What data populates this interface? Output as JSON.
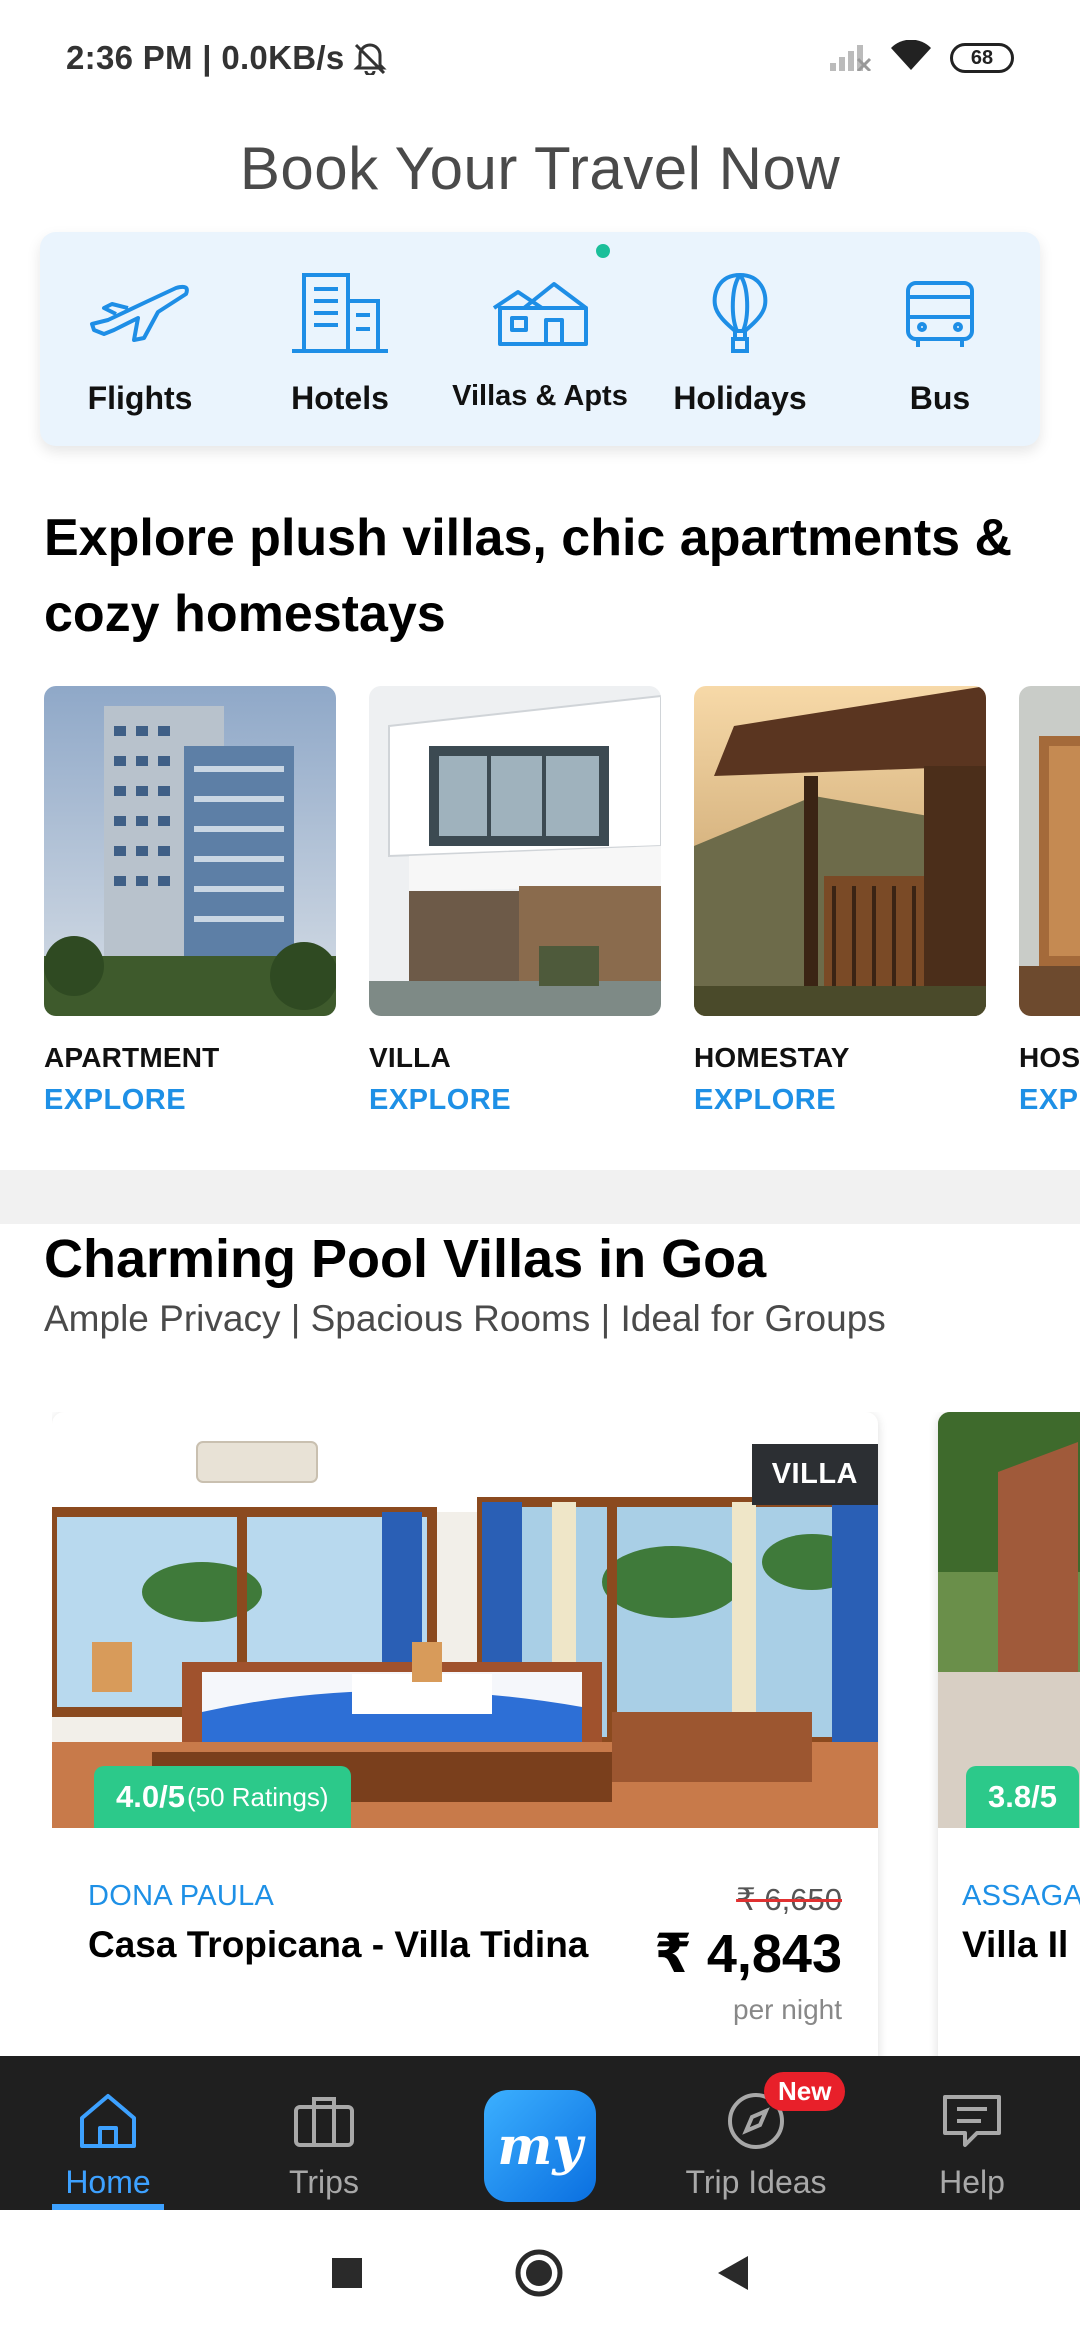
{
  "status_bar": {
    "time": "2:36 PM",
    "speed": "0.0KB/s",
    "battery": "68"
  },
  "page_title": "Book Your Travel Now",
  "categories": [
    {
      "label": "Flights",
      "icon": "airplane-icon"
    },
    {
      "label": "Hotels",
      "icon": "building-icon"
    },
    {
      "label": "Villas & Apts",
      "icon": "house-icon"
    },
    {
      "label": "Holidays",
      "icon": "hot-air-balloon-icon"
    },
    {
      "label": "Bus",
      "icon": "bus-icon"
    }
  ],
  "section_explore": {
    "title": "Explore plush villas, chic apartments & cozy homestays",
    "items": [
      {
        "name": "APARTMENT",
        "cta": "EXPLORE"
      },
      {
        "name": "VILLA",
        "cta": "EXPLORE"
      },
      {
        "name": "HOMESTAY",
        "cta": "EXPLORE"
      },
      {
        "name": "HOSTEL",
        "cta": "EXPLORE"
      }
    ]
  },
  "section_goa": {
    "title": "Charming Pool Villas in Goa",
    "subtitle": "Ample Privacy | Spacious Rooms | Ideal for Groups",
    "cards": [
      {
        "tag": "VILLA",
        "rating": "4.0/5",
        "rating_count": "(50 Ratings)",
        "location": "DONA PAULA",
        "name": "Casa Tropicana - Villa Tidina",
        "old_price": "₹ 6,650",
        "price": "₹ 4,843",
        "per": "per night"
      },
      {
        "tag": "",
        "rating": "3.8/5",
        "rating_count": "",
        "location": "ASSAGAO",
        "name": "Villa Il",
        "old_price": "",
        "price": "",
        "per": ""
      }
    ]
  },
  "bottom_nav": [
    {
      "label": "Home",
      "icon": "home-icon",
      "active": true
    },
    {
      "label": "Trips",
      "icon": "briefcase-icon"
    },
    {
      "label": "my",
      "icon": "makemytrip-logo"
    },
    {
      "label": "Trip Ideas",
      "icon": "compass-icon",
      "badge": "New"
    },
    {
      "label": "Help",
      "icon": "chat-help-icon"
    }
  ],
  "colors": {
    "accent": "#1e90e6",
    "rating": "#2cc98a",
    "nav_bg": "#1f1f1f",
    "card_bg": "#eaf4fd"
  }
}
